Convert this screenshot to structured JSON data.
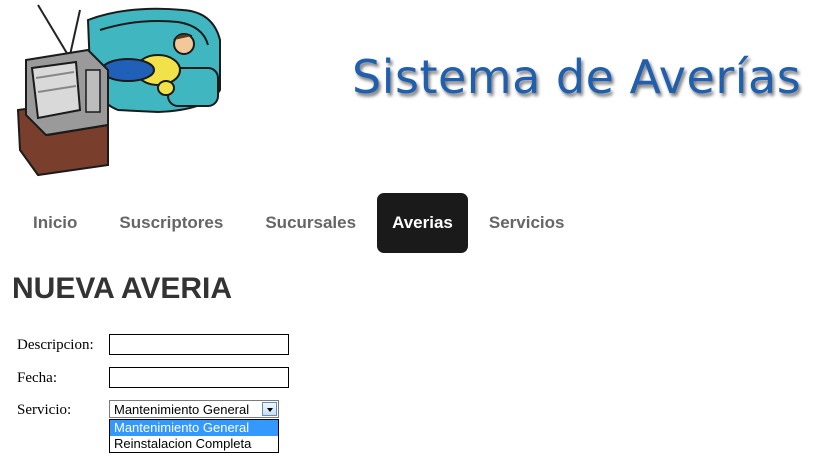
{
  "header": {
    "app_title": "Sistema de Averías"
  },
  "nav": {
    "items": [
      {
        "label": "Inicio"
      },
      {
        "label": "Suscriptores"
      },
      {
        "label": "Sucursales"
      },
      {
        "label": "Averias",
        "active": true
      },
      {
        "label": "Servicios"
      }
    ]
  },
  "page": {
    "heading": "NUEVA AVERIA"
  },
  "form": {
    "descripcion_label": "Descripcion:",
    "descripcion_value": "",
    "fecha_label": "Fecha:",
    "fecha_value": "",
    "servicio_label": "Servicio:",
    "servicio_selected": "Mantenimiento General",
    "servicio_options": [
      "Mantenimiento General",
      "Reinstalacion Completa"
    ]
  },
  "colors": {
    "title_blue": "#1f5fae",
    "nav_active_bg": "#1a1a1a",
    "nav_text": "#666666",
    "option_highlight": "#3399ff"
  }
}
